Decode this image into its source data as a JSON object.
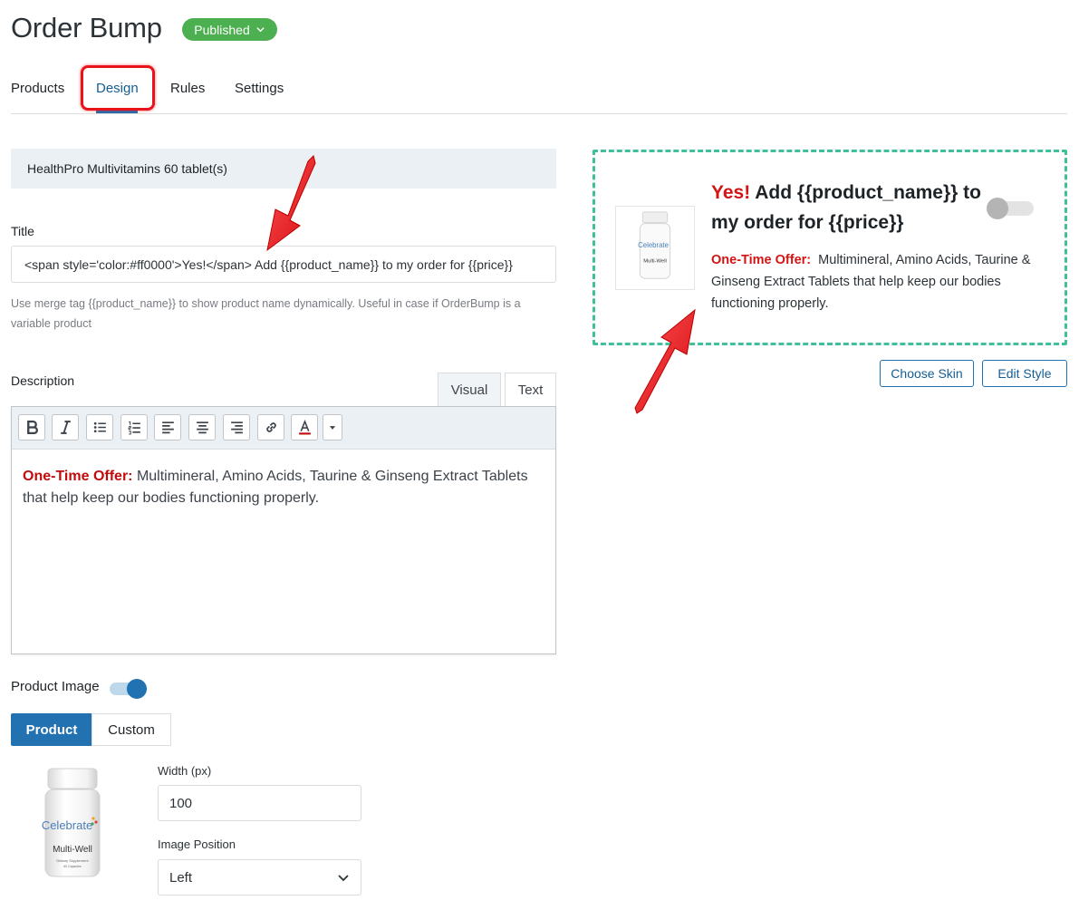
{
  "header": {
    "title": "Order Bump",
    "status": "Published"
  },
  "tabs": [
    {
      "label": "Products"
    },
    {
      "label": "Design",
      "active": true
    },
    {
      "label": "Rules"
    },
    {
      "label": "Settings"
    }
  ],
  "product_strip": "HealthPro Multivitamins 60 tablet(s)",
  "title_field": {
    "label": "Title",
    "value": "<span style='color:#ff0000'>Yes!</span> Add {{product_name}} to my order for {{price}}",
    "help": "Use merge tag {{product_name}} to show product name dynamically. Useful in case if OrderBump is a variable product"
  },
  "description": {
    "label": "Description",
    "tab_visual": "Visual",
    "tab_text": "Text",
    "offer_label": "One-Time Offer:",
    "offer_text": "Multimineral, Amino Acids, Taurine & Ginseng Extract Tablets that help keep our bodies functioning properly."
  },
  "toolbar": {
    "icons": [
      "bold-icon",
      "italic-icon",
      "bullet-list-icon",
      "numbered-list-icon",
      "align-left-icon",
      "align-center-icon",
      "align-right-icon",
      "link-icon",
      "text-color-icon",
      "dropdown-arrow-icon"
    ]
  },
  "product_image": {
    "label": "Product Image",
    "enabled": true,
    "seg_product": "Product",
    "seg_custom": "Custom",
    "width_label": "Width (px)",
    "width_value": "100",
    "position_label": "Image Position",
    "position_value": "Left",
    "bottle_brand": "Celebrate",
    "bottle_product": "Multi-Well",
    "bottle_sub1": "Dietary Supplement",
    "bottle_sub2": "60 Capsules"
  },
  "preview": {
    "yes": "Yes!",
    "title_rest": "Add {{product_name}} to my order for {{price}}",
    "offer_label": "One-Time Offer:",
    "offer_text": "Multimineral, Amino Acids, Taurine & Ginseng Extract Tablets that help keep our bodies functioning properly.",
    "toggle_on": false
  },
  "actions": {
    "choose_skin": "Choose Skin",
    "edit_style": "Edit Style"
  },
  "colors": {
    "brand_blue": "#2271b1",
    "published_green": "#4caf50",
    "offer_red": "#c20c0c",
    "dashed_teal": "#3fbf9a",
    "annotation_red": "#e8131b"
  }
}
